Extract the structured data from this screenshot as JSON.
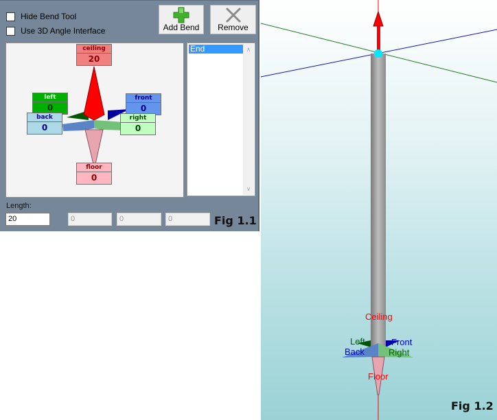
{
  "bend_tool": {
    "options": [
      {
        "label": "Hide Bend Tool",
        "checked": false
      },
      {
        "label": "Use 3D Angle Interface",
        "checked": false
      }
    ],
    "toolbar": {
      "add_label": "Add Bend",
      "add_icon": "plus-icon",
      "remove_label": "Remove",
      "remove_icon": "x-icon"
    },
    "directions": {
      "ceiling": {
        "label": "ceiling",
        "value": "20"
      },
      "left": {
        "label": "left",
        "value": "0"
      },
      "front": {
        "label": "front",
        "value": "0"
      },
      "back": {
        "label": "back",
        "value": "0"
      },
      "right": {
        "label": "right",
        "value": "0"
      },
      "floor": {
        "label": "floor",
        "value": "0"
      }
    },
    "bend_list": [
      "End"
    ],
    "length": {
      "label": "Length:",
      "value": "20"
    },
    "coords": [
      "0",
      "0",
      "0"
    ],
    "caption": "Fig 1.1"
  },
  "viewport": {
    "labels": {
      "ceiling": "Ceiling",
      "left": "Left",
      "front": "Front",
      "back": "Back",
      "right": "Right",
      "floor": "Floor"
    },
    "caption": "Fig 1.2"
  },
  "colors": {
    "ceiling": "#f08080",
    "left": "#00b000",
    "front": "#6495ed",
    "back": "#add8e6",
    "right": "#c0ffc0",
    "floor": "#ffb6c1",
    "selection": "#3399ff"
  }
}
